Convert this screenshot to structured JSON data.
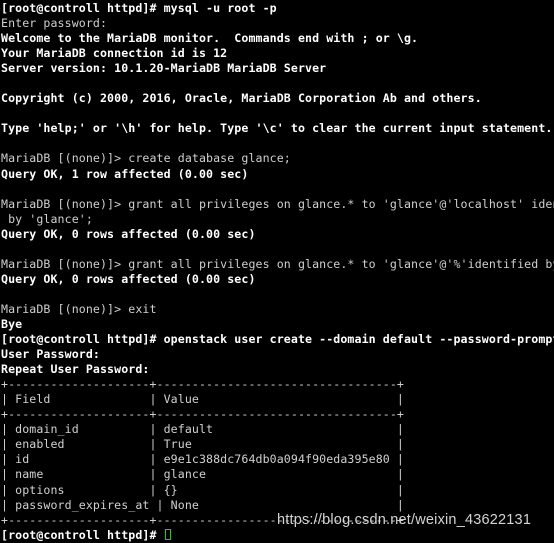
{
  "terminal": {
    "background_color": "#000000",
    "foreground_color": "#d8d8d8",
    "bold_color": "#ffffff",
    "cursor_color": "#18d318",
    "columns": 71,
    "lines": [
      {
        "text": "[root@controll httpd]# mysql -u root -p",
        "style": "bold"
      },
      {
        "text": "Enter password:",
        "style": "normal"
      },
      {
        "text": "Welcome to the MariaDB monitor.  Commands end with ; or \\g.",
        "style": "bold"
      },
      {
        "text": "Your MariaDB connection id is 12",
        "style": "bold"
      },
      {
        "text": "Server version: 10.1.20-MariaDB MariaDB Server",
        "style": "bold"
      },
      {
        "text": "",
        "style": "normal"
      },
      {
        "text": "Copyright (c) 2000, 2016, Oracle, MariaDB Corporation Ab and others.",
        "style": "bold"
      },
      {
        "text": "",
        "style": "normal"
      },
      {
        "text": "Type 'help;' or '\\h' for help. Type '\\c' to clear the current input statement.",
        "style": "bold"
      },
      {
        "text": "",
        "style": "normal"
      },
      {
        "text": "MariaDB [(none)]> create database glance;",
        "style": "normal"
      },
      {
        "text": "Query OK, 1 row affected (0.00 sec)",
        "style": "bold"
      },
      {
        "text": "",
        "style": "normal"
      },
      {
        "text": "MariaDB [(none)]> grant all privileges on glance.* to 'glance'@'localhost' identified",
        "style": "normal"
      },
      {
        "text": " by 'glance';",
        "style": "normal"
      },
      {
        "text": "Query OK, 0 rows affected (0.00 sec)",
        "style": "bold"
      },
      {
        "text": "",
        "style": "normal"
      },
      {
        "text": "MariaDB [(none)]> grant all privileges on glance.* to 'glance'@'%'identified by 'glance';",
        "style": "normal"
      },
      {
        "text": "Query OK, 0 rows affected (0.00 sec)",
        "style": "bold"
      },
      {
        "text": "",
        "style": "normal"
      },
      {
        "text": "MariaDB [(none)]> exit",
        "style": "normal"
      },
      {
        "text": "Bye",
        "style": "bold"
      },
      {
        "text": "[root@controll httpd]# openstack user create --domain default --password-prompt glance",
        "style": "bold"
      },
      {
        "text": "User Password:",
        "style": "bold"
      },
      {
        "text": "Repeat User Password:",
        "style": "bold"
      },
      {
        "text": "+--------------------+----------------------------------+",
        "style": "table"
      },
      {
        "text": "| Field              | Value                            |",
        "style": "table"
      },
      {
        "text": "+--------------------+----------------------------------+",
        "style": "table"
      },
      {
        "text": "| domain_id          | default                          |",
        "style": "table"
      },
      {
        "text": "| enabled            | True                             |",
        "style": "table"
      },
      {
        "text": "| id                 | e9e1c388dc764db0a094f90eda395e80 |",
        "style": "table"
      },
      {
        "text": "| name               | glance                           |",
        "style": "table"
      },
      {
        "text": "| options            | {}                               |",
        "style": "table"
      },
      {
        "text": "| password_expires_at | None                            |",
        "style": "table"
      },
      {
        "text": "+--------------------+----------------------------------+",
        "style": "table"
      }
    ],
    "final_prompt": "[root@controll httpd]# "
  },
  "result_table": {
    "headers": [
      "Field",
      "Value"
    ],
    "rows": [
      {
        "field": "domain_id",
        "value": "default"
      },
      {
        "field": "enabled",
        "value": "True"
      },
      {
        "field": "id",
        "value": "e9e1c388dc764db0a094f90eda395e80"
      },
      {
        "field": "name",
        "value": "glance"
      },
      {
        "field": "options",
        "value": "{}"
      },
      {
        "field": "password_expires_at",
        "value": "None"
      }
    ]
  },
  "watermark": {
    "text": "https://blog.csdn.net/weixin_43622131"
  }
}
